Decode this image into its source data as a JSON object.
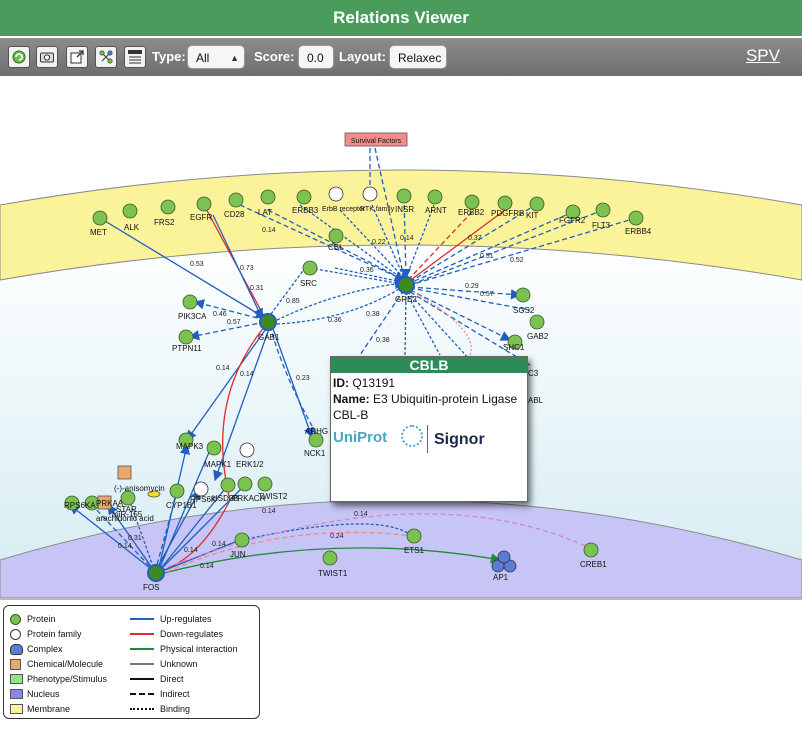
{
  "window": {
    "title": "Relations Viewer",
    "spv_link": "SPV"
  },
  "toolbar": {
    "icons": [
      "refresh-icon",
      "camera-icon",
      "export-icon",
      "network-layout-icon",
      "toggle-onoff-icon"
    ],
    "type_label": "Type:",
    "type_value": "All",
    "score_label": "Score:",
    "score_value": "0.0",
    "layout_label": "Layout:",
    "layout_value": "Relaxec"
  },
  "colors": {
    "title_bg": "#4a9b5c",
    "protein": "#7cc251",
    "up_regulates": "#1f5fbf",
    "down_regulates": "#e02b2b",
    "physical": "#1e8a3a",
    "membrane": "#fbf39a",
    "nucleus": "#c7c5f5",
    "tooltip_header": "#2e8b57"
  },
  "diagram": {
    "phenotype": "Survival Factors",
    "nodes": {
      "met": "MET",
      "alk": "ALK",
      "frs2": "FRS2",
      "egfr": "EGFR",
      "cd28": "CD28",
      "lat": "LAT",
      "erbb3": "ERBB3",
      "erbb_receptor": "ErbB receptor",
      "rtk_family": "RTK family",
      "nsr": "INSR",
      "arnt": "ARNT",
      "erbb2": "ERBB2",
      "pdgfrb": "PDGFRB",
      "kit": "KIT",
      "fgfr2": "FGFR2",
      "flt3": "FLT3",
      "erbb4": "ERBB4",
      "cbl": "CBL",
      "src": "SRC",
      "grb2": "GRB2",
      "sgs2": "SGS2",
      "gab2": "GAB2",
      "shc1": "SHC1",
      "c3": "C3",
      "abl": "ABL",
      "pik3ca": "PIK3CA",
      "ptpn11": "PTPN11",
      "gab1": "GAB1",
      "arhg": "ARHG",
      "nck1": "NCK1",
      "mapk3": "MAPK3",
      "mapk1": "MAPK1",
      "erk12": "ERK1/2",
      "anisomycin": "(-)-anisomycin",
      "arachidonic": "arachidonic acid",
      "mir155": "miR-155",
      "star": "STAR",
      "rps6ka": "RPS6KA",
      "prkaa": "PRKAA",
      "cyp1b1": "CYP1B1",
      "rps6k": "RPS6K",
      "ksd3b": "HSD3B",
      "prkaca": "PRKACA",
      "twist2": "TWIST2",
      "jun": "JUN",
      "fos": "FOS",
      "twist1": "TWIST1",
      "ets1": "ETS1",
      "ap1": "AP1",
      "creb1": "CREB1"
    },
    "edge_scores": {
      "met_gab1": "0.53",
      "egfr_gab1": "0.73",
      "egfr_gab1b": "0.31",
      "gab1_pik3": "0.46",
      "gab1_ptpn": "0.57",
      "gab1_src": "0.85",
      "grb2_gab1": "0.36",
      "gab1_mapk3": "0.14",
      "gab1_mapk1": "0.14",
      "gab1_nck": "0.23",
      "cd28_grb2": "0.14",
      "lat_grb2": "0.36",
      "erbb3_grb2": "0.22",
      "nsr_grb2": "0.14",
      "pdgfrb_grb2": "0.37",
      "kit_grb2": "0.51",
      "flt3_grb2": "0.52",
      "grb2_sgs2": "0.29",
      "grb2_shc1": "0.57",
      "twist_jun": "0.14",
      "fos_jun": "0.14",
      "jun_ap1": "0.24",
      "jun_ets1": "0.14",
      "fos_a": "0.14",
      "fos_b": "0.31",
      "fos_c": "0.14",
      "fos_d": "0.14",
      "x1": "0.38",
      "x2": "0.38"
    }
  },
  "tooltip": {
    "title": "CBLB",
    "id_label": "ID:",
    "id_value": "Q13191",
    "name_label": "Name:",
    "name_value": "E3 Ubiquitin-protein Ligase CBL-B",
    "logo_uniprot": "UniProt",
    "logo_signor": "Signor"
  },
  "legend": {
    "protein": "Protein",
    "protein_family": "Protein family",
    "complex": "Complex",
    "chemical": "Chemical/Molecule",
    "phenotype": "Phenotype/Stimulus",
    "nucleus": "Nucleus",
    "membrane": "Membrane",
    "up": "Up-regulates",
    "down": "Down-regulates",
    "physical": "Physical interaction",
    "unknown": "Unknown",
    "direct": "Direct",
    "indirect": "Indirect",
    "binding": "Binding"
  }
}
